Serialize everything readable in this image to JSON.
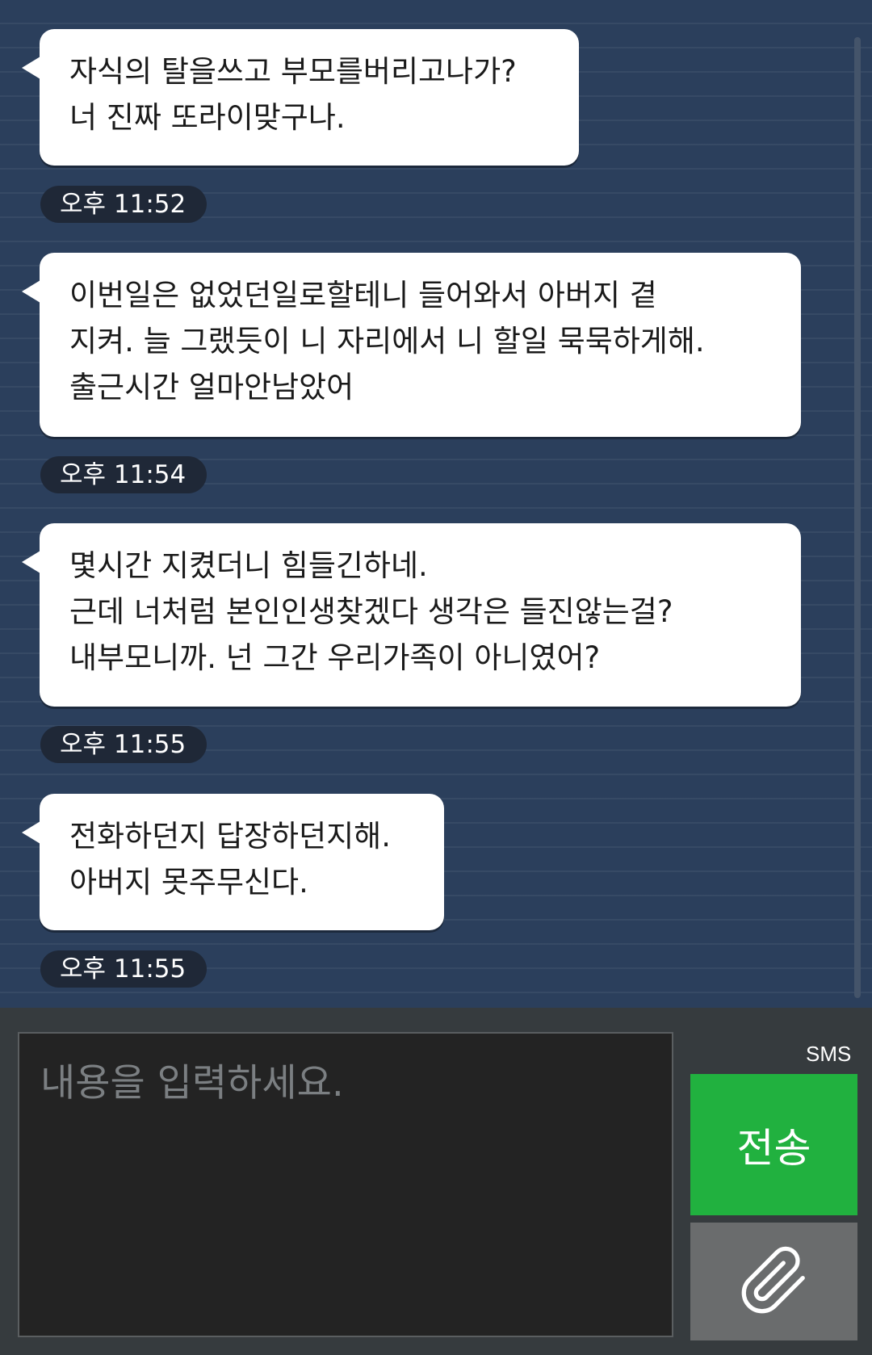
{
  "messages": [
    {
      "text": "자식의 탈을쓰고 부모를버리고나가?\n너 진짜 또라이맞구나.",
      "time": "오후 11:52"
    },
    {
      "text": "이번일은 없었던일로할테니 들어와서 아버지 곁\n지켜. 늘 그랬듯이 니 자리에서 니 할일 묵묵하게해.\n출근시간 얼마안남았어",
      "time": "오후 11:54"
    },
    {
      "text": "몇시간 지켰더니 힘들긴하네.\n근데 너처럼 본인인생찾겠다 생각은 들진않는걸?\n내부모니까. 넌 그간 우리가족이 아니였어?",
      "time": "오후 11:55"
    },
    {
      "text": "전화하던지 답장하던지해.\n아버지 못주무신다.",
      "time": "오후 11:55"
    }
  ],
  "composer": {
    "placeholder": "내용을 입력하세요.",
    "value": "",
    "mode_label": "SMS",
    "send_label": "전송"
  },
  "icons": {
    "attach": "paperclip-icon"
  },
  "colors": {
    "chat_background": "#2b3f5c",
    "bubble": "#ffffff",
    "timestamp_pill": "#1f2837",
    "send_button": "#21b13f",
    "attach_button": "#6a6c6d"
  }
}
